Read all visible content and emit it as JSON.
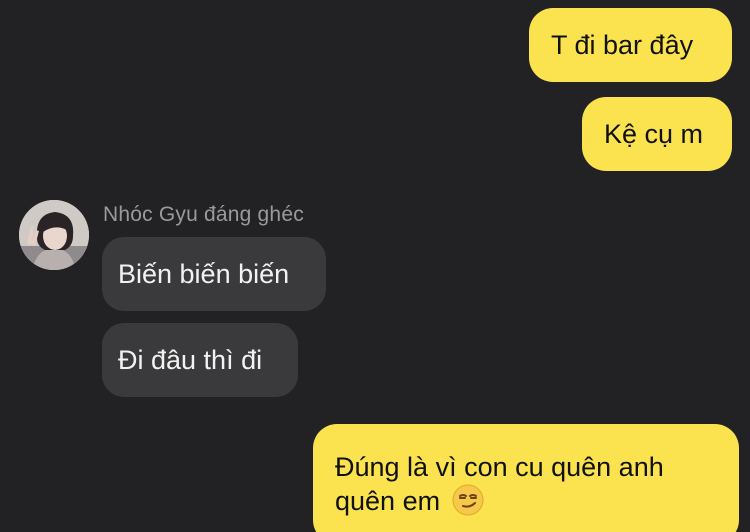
{
  "conversation": {
    "contact_name": "Nhóc Gyu đáng ghéc",
    "messages": [
      {
        "sender": "me",
        "text": "T đi bar đây"
      },
      {
        "sender": "me",
        "text": "Kệ cụ m"
      },
      {
        "sender": "them",
        "text": "Biến biến biến"
      },
      {
        "sender": "them",
        "text": "Đi đâu thì đi"
      },
      {
        "sender": "me",
        "text": "Đúng là vì con cu quên anh\nquên em",
        "emoji": "smirking-face-emoji"
      }
    ]
  },
  "colors": {
    "background": "#222224",
    "outgoing_bubble": "#fae34e",
    "incoming_bubble": "#3a3a3c",
    "contact_name_text": "#9a9a9c"
  },
  "icons": {
    "avatar": "contact-avatar",
    "emoji": "smirking-face-emoji"
  }
}
